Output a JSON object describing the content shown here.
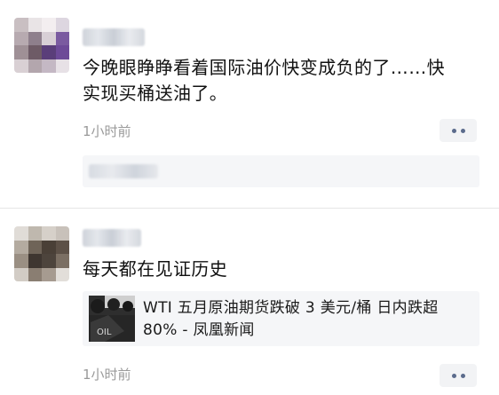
{
  "comments": [
    {
      "text_line1": "今晚眼睁睁看着国际油价快变成负的了……快",
      "text_line2": "实现买桶送油了。",
      "time": "1小时前",
      "more_icon": "ellipsis-icon"
    },
    {
      "text": "每天都在见证历史",
      "link_title_line1": "WTI 五月原油期货跌破 3 美元/桶 日内跌超",
      "link_title_line2": "80% - 凤凰新闻",
      "thumb_label": "OIL",
      "time": "1小时前",
      "more_icon": "ellipsis-icon"
    }
  ],
  "colors": {
    "accent": "#5b6b8c",
    "muted_text": "#9a9a9a",
    "panel_bg": "#f5f6f8"
  }
}
